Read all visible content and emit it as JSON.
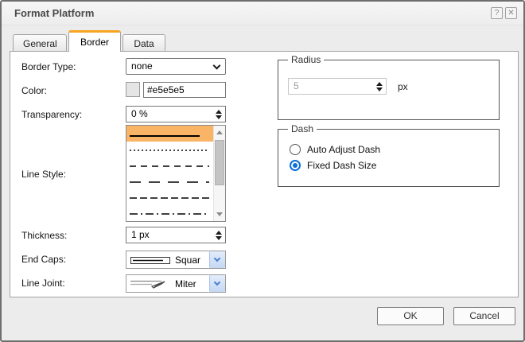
{
  "dialog": {
    "title": "Format Platform"
  },
  "icons": {
    "help": "?",
    "close": "✕"
  },
  "tabs": [
    {
      "label": "General",
      "active": false
    },
    {
      "label": "Border",
      "active": true
    },
    {
      "label": "Data",
      "active": false
    }
  ],
  "fields": {
    "border_type": {
      "label": "Border Type:",
      "value": "none"
    },
    "color": {
      "label": "Color:",
      "value": "#e5e5e5",
      "swatch_color": "#e5e5e5"
    },
    "transparency": {
      "label": "Transparency:",
      "value": "0 %"
    },
    "line_style": {
      "label": "Line Style:",
      "options": [
        {
          "name": "solid",
          "dash": "",
          "selected": true
        },
        {
          "name": "dotted",
          "dash": "2,3",
          "selected": false
        },
        {
          "name": "dashed",
          "dash": "8,6",
          "selected": false
        },
        {
          "name": "long-dash",
          "dash": "14,10",
          "selected": false
        },
        {
          "name": "medium-dash",
          "dash": "9,4",
          "selected": false
        },
        {
          "name": "dash-dot",
          "dash": "10,4,2,4",
          "selected": false
        }
      ]
    },
    "thickness": {
      "label": "Thickness:",
      "value": "1 px"
    },
    "end_caps": {
      "label": "End Caps:",
      "value": "Squar"
    },
    "line_joint": {
      "label": "Line Joint:",
      "value": "Miter"
    }
  },
  "radius_group": {
    "legend": "Radius",
    "value": "5",
    "unit": "px",
    "disabled": true
  },
  "dash_group": {
    "legend": "Dash",
    "options": [
      {
        "label": "Auto Adjust Dash",
        "selected": false
      },
      {
        "label": "Fixed Dash Size",
        "selected": true
      }
    ]
  },
  "footer": {
    "ok_label": "OK",
    "cancel_label": "Cancel"
  },
  "colors": {
    "selection_orange": "#f9b465",
    "tab_accent_orange": "#f7a420",
    "radio_blue": "#0d6fd8",
    "dropdown_button_blue": "#c4d8f3"
  }
}
